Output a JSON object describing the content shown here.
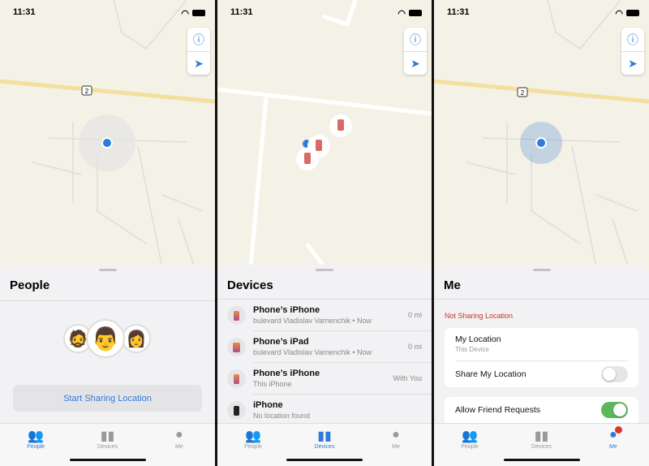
{
  "status": {
    "time": "11:31"
  },
  "tabs": [
    {
      "label": "People",
      "icon": "people-icon"
    },
    {
      "label": "Devices",
      "icon": "devices-icon"
    },
    {
      "label": "Me",
      "icon": "person-circle-icon"
    }
  ],
  "map": {
    "road_label": "2",
    "info_icon": "info-icon",
    "location_icon": "location-arrow-icon"
  },
  "people": {
    "title": "People",
    "button": "Start Sharing Location"
  },
  "devices": {
    "title": "Devices",
    "items": [
      {
        "name": "Phone’s iPhone",
        "subtitle": "bulevard Vladislav Varnenchik • Now",
        "distance": "0 mi"
      },
      {
        "name": "Phone’s iPad",
        "subtitle": "bulevard Vladislav Varnenchik • Now",
        "distance": "0 mi"
      },
      {
        "name": "Phone’s iPhone",
        "subtitle": "This iPhone",
        "distance": "With You"
      },
      {
        "name": "iPhone",
        "subtitle": "No location found",
        "distance": ""
      }
    ]
  },
  "me": {
    "title": "Me",
    "status": "Not Sharing Location",
    "status_color": "#c0392b",
    "my_location": "My Location",
    "my_location_sub": "This Device",
    "share_label": "Share My Location",
    "share_on": false,
    "friend_label": "Allow Friend Requests",
    "friend_on": true
  },
  "colors": {
    "accent": "#2f7bd9",
    "toggle_on": "#5cb85c",
    "badge": "#e0332b"
  }
}
